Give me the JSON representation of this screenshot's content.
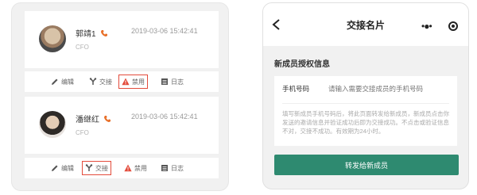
{
  "left_panel": {
    "cards": [
      {
        "name": "郭靖1",
        "time": "2019-03-06 15:42:41",
        "role": "CFO",
        "actions": [
          "编辑",
          "交接",
          "禁用",
          "日志"
        ]
      },
      {
        "name": "潘继红",
        "time": "2019-03-06 15:42:41",
        "role": "CFO",
        "actions": [
          "编辑",
          "交接",
          "禁用",
          "日志"
        ]
      }
    ],
    "accent_color": "#e34b3b"
  },
  "right_panel": {
    "title": "交接名片",
    "section_title": "新成员授权信息",
    "phone_label": "手机号码",
    "phone_placeholder": "请输入需要交接成员的手机号码",
    "help_text": "填写新成员手机号码后，将此页面转发给新成员，新成员点击你发送的邀请信息并验证成功后即为交接成功。不点击或验证信息不对，交接不成功。有效期为24小时。",
    "submit_label": "转发给新成员",
    "submit_color": "#2e8a70"
  }
}
